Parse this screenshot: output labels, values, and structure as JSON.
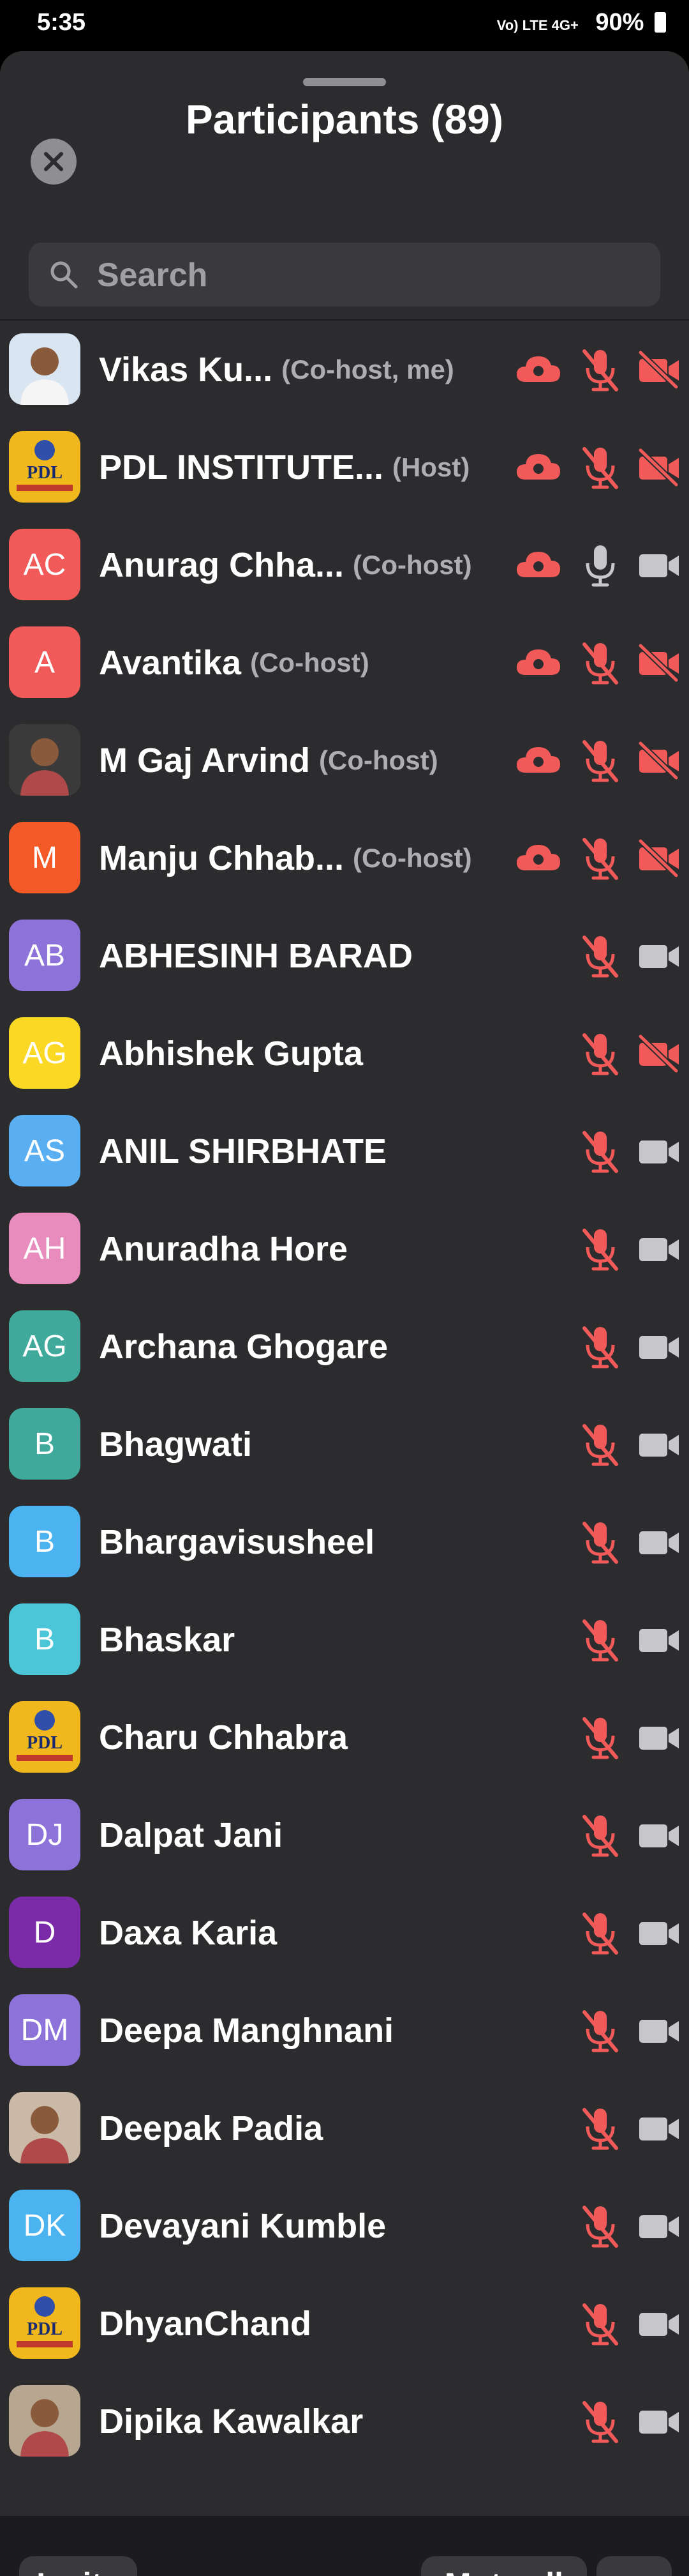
{
  "status": {
    "time": "5:35",
    "battery": "90%",
    "network": "Vo) LTE 4G+"
  },
  "header": {
    "title": "Participants (89)"
  },
  "search": {
    "placeholder": "Search"
  },
  "participants": [
    {
      "name": "Vikas Ku...",
      "role": "(Co-host, me)",
      "initials": "",
      "avatar_color": "#d9e6f2",
      "photo": true,
      "cloud": true,
      "mic": "muted",
      "video": "off"
    },
    {
      "name": "PDL INSTITUTE...",
      "role": "(Host)",
      "initials": "PDL",
      "avatar_color": "#f0b81c",
      "photo": true,
      "cloud": true,
      "mic": "muted",
      "video": "off"
    },
    {
      "name": "Anurag Chha...",
      "role": "(Co-host)",
      "initials": "AC",
      "avatar_color": "#f25a5a",
      "photo": false,
      "cloud": true,
      "mic": "on",
      "video": "on"
    },
    {
      "name": "Avantika",
      "role": "(Co-host)",
      "initials": "A",
      "avatar_color": "#f25a5a",
      "photo": false,
      "cloud": true,
      "mic": "muted",
      "video": "off"
    },
    {
      "name": "M Gaj Arvind",
      "role": "(Co-host)",
      "initials": "",
      "avatar_color": "#3a3a3a",
      "photo": true,
      "cloud": true,
      "mic": "muted",
      "video": "off"
    },
    {
      "name": "Manju Chhab...",
      "role": "(Co-host)",
      "initials": "M",
      "avatar_color": "#f45a28",
      "photo": false,
      "cloud": true,
      "mic": "muted",
      "video": "off"
    },
    {
      "name": "ABHESINH BARAD",
      "role": "",
      "initials": "AB",
      "avatar_color": "#8c72d9",
      "photo": false,
      "cloud": false,
      "mic": "muted",
      "video": "on"
    },
    {
      "name": "Abhishek Gupta",
      "role": "",
      "initials": "AG",
      "avatar_color": "#fbd823",
      "photo": false,
      "cloud": false,
      "mic": "muted",
      "video": "off"
    },
    {
      "name": "ANIL SHIRBHATE",
      "role": "",
      "initials": "AS",
      "avatar_color": "#5aaef2",
      "photo": false,
      "cloud": false,
      "mic": "muted",
      "video": "on"
    },
    {
      "name": "Anuradha Hore",
      "role": "",
      "initials": "AH",
      "avatar_color": "#e88bbd",
      "photo": false,
      "cloud": false,
      "mic": "muted",
      "video": "on"
    },
    {
      "name": "Archana Ghogare",
      "role": "",
      "initials": "AG",
      "avatar_color": "#3faa9c",
      "photo": false,
      "cloud": false,
      "mic": "muted",
      "video": "on"
    },
    {
      "name": "Bhagwati",
      "role": "",
      "initials": "B",
      "avatar_color": "#3faa9c",
      "photo": false,
      "cloud": false,
      "mic": "muted",
      "video": "on"
    },
    {
      "name": "Bhargavisusheel",
      "role": "",
      "initials": "B",
      "avatar_color": "#4ab3f0",
      "photo": false,
      "cloud": false,
      "mic": "muted",
      "video": "on"
    },
    {
      "name": "Bhaskar",
      "role": "",
      "initials": "B",
      "avatar_color": "#4ac6d8",
      "photo": false,
      "cloud": false,
      "mic": "muted",
      "video": "on"
    },
    {
      "name": "Charu Chhabra",
      "role": "",
      "initials": "PDL",
      "avatar_color": "#f0b81c",
      "photo": true,
      "cloud": false,
      "mic": "muted",
      "video": "on"
    },
    {
      "name": "Dalpat Jani",
      "role": "",
      "initials": "DJ",
      "avatar_color": "#8c72d9",
      "photo": false,
      "cloud": false,
      "mic": "muted",
      "video": "on"
    },
    {
      "name": "Daxa Karia",
      "role": "",
      "initials": "D",
      "avatar_color": "#7b2aa8",
      "photo": false,
      "cloud": false,
      "mic": "muted",
      "video": "on"
    },
    {
      "name": "Deepa Manghnani",
      "role": "",
      "initials": "DM",
      "avatar_color": "#8c72d9",
      "photo": false,
      "cloud": false,
      "mic": "muted",
      "video": "on"
    },
    {
      "name": "Deepak Padia",
      "role": "",
      "initials": "",
      "avatar_color": "#c9b9a6",
      "photo": true,
      "cloud": false,
      "mic": "muted",
      "video": "on"
    },
    {
      "name": "Devayani Kumble",
      "role": "",
      "initials": "DK",
      "avatar_color": "#4ab3f0",
      "photo": false,
      "cloud": false,
      "mic": "muted",
      "video": "on"
    },
    {
      "name": "DhyanChand",
      "role": "",
      "initials": "PDL",
      "avatar_color": "#f0b81c",
      "photo": true,
      "cloud": false,
      "mic": "muted",
      "video": "on"
    },
    {
      "name": "Dipika Kawalkar",
      "role": "",
      "initials": "",
      "avatar_color": "#b7a690",
      "photo": true,
      "cloud": false,
      "mic": "muted",
      "video": "on"
    }
  ],
  "footer": {
    "invite": "Invite",
    "mute_all": "Mute all",
    "more": "···"
  },
  "colors": {
    "muted_red": "#f25a5a",
    "icon_gray": "#c7c7cc",
    "sheet_bg": "#2c2c2e"
  }
}
